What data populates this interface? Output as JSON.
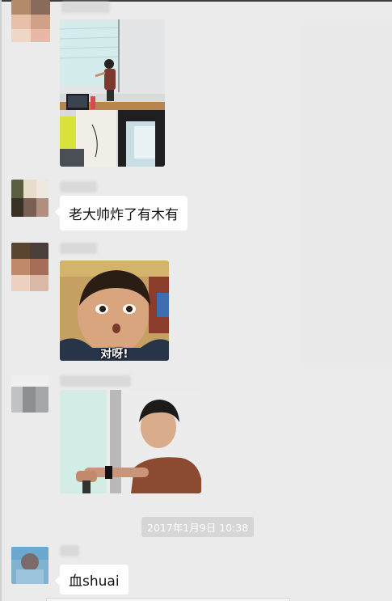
{
  "chat": {
    "timestamp": "2017年1月9日 10:38",
    "messages": [
      {
        "type": "image",
        "image_description": "classroom-lecture-photo"
      },
      {
        "type": "text",
        "text": "老大帅炸了有木有"
      },
      {
        "type": "image",
        "image_description": "boy-sticker",
        "caption": "对呀!"
      },
      {
        "type": "image",
        "image_description": "man-checking-watch-photo"
      },
      {
        "type": "text",
        "text": "血shuai"
      }
    ]
  },
  "colors": {
    "background": "#ebebeb",
    "bubble": "#ffffff",
    "timestamp_bg": "#d6d6d6",
    "caption_color": "#ffffff"
  }
}
